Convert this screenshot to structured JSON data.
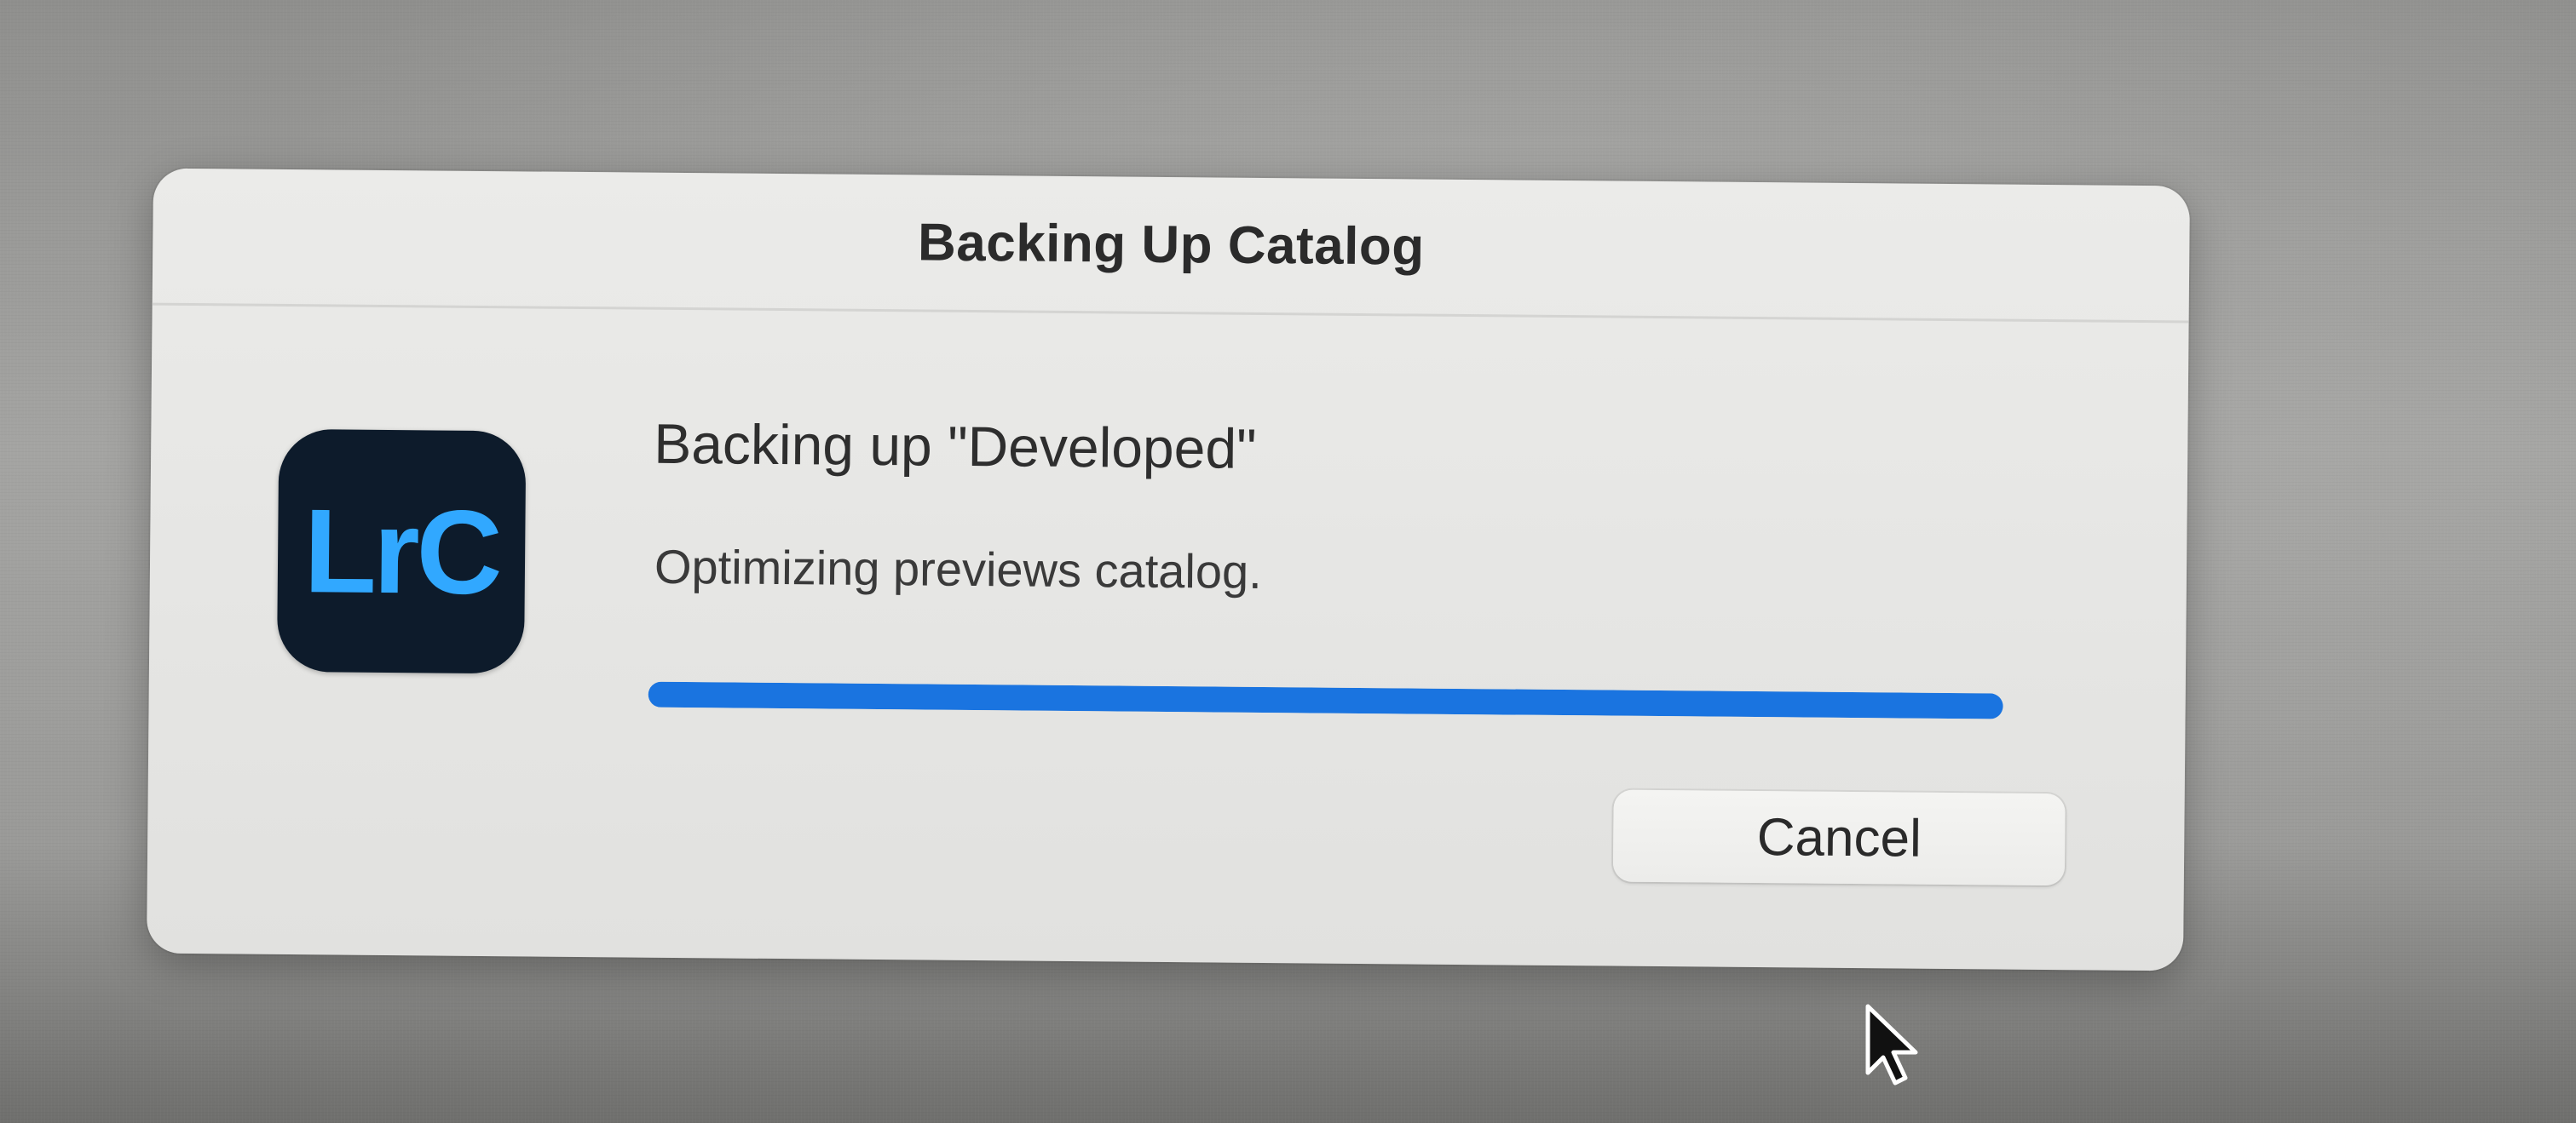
{
  "dialog": {
    "title": "Backing Up Catalog",
    "message": "Backing up \"Developed\"",
    "detail": "Optimizing previews catalog.",
    "progress": 1.0,
    "cancel_label": "Cancel"
  },
  "app_icon": {
    "name": "lightroom-classic-icon",
    "label": "LrC",
    "background_color": "#0d1b2b",
    "text_color": "#31a8ff"
  },
  "colors": {
    "accent": "#1a74e0"
  }
}
